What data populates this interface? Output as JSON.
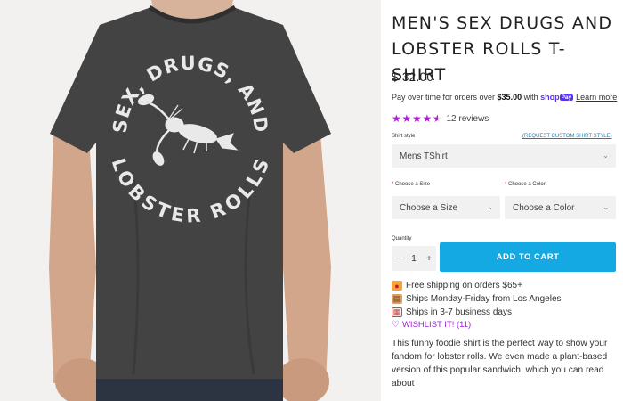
{
  "product": {
    "title": "MEN'S SEX DRUGS AND LOBSTER ROLLS T-SHIRT",
    "price": "$ 32.00",
    "shirt_print": {
      "top_arc": "SEX, DRUGS, AND",
      "bottom_arc": "LOBSTER ROLLS"
    }
  },
  "payment": {
    "text_before": "Pay over time for orders over ",
    "amount": "$35.00",
    "text_after": " with ",
    "brand": "shop",
    "brand_suffix": "Pay",
    "learn_more": "Learn more"
  },
  "rating": {
    "stars": 4.5,
    "star_glyph": "★",
    "reviews": "12 reviews",
    "color": "#b01fe0"
  },
  "options": {
    "shirt_style_label": "Shirt style",
    "request_custom": "(REQUEST CUSTOM SHIRT STYLE)",
    "shirt_style_value": "Mens TShirt",
    "size_label": "Choose a Size",
    "size_placeholder": "Choose a Size",
    "color_label": "Choose a Color",
    "color_placeholder": "Choose a Color",
    "required_mark": "*",
    "chevron": "⌄"
  },
  "cart": {
    "quantity_label": "Quantity",
    "minus": "−",
    "quantity": "1",
    "plus": "+",
    "add_to_cart": "ADD TO CART",
    "button_color": "#14a9e3"
  },
  "perks": [
    {
      "icon": "shipping-icon",
      "text": "Free shipping on orders $65+"
    },
    {
      "icon": "box-icon",
      "text": "Ships Monday-Friday from Los Angeles"
    },
    {
      "icon": "calendar-icon",
      "text": "Ships in 3-7 business days"
    }
  ],
  "wishlist": {
    "label": "WISHLIST IT! (11)",
    "color": "#a020e0"
  },
  "description": "This funny foodie shirt is the perfect way to show your fandom for lobster rolls. We even made a plant-based version of this popular sandwich, which you can read about"
}
